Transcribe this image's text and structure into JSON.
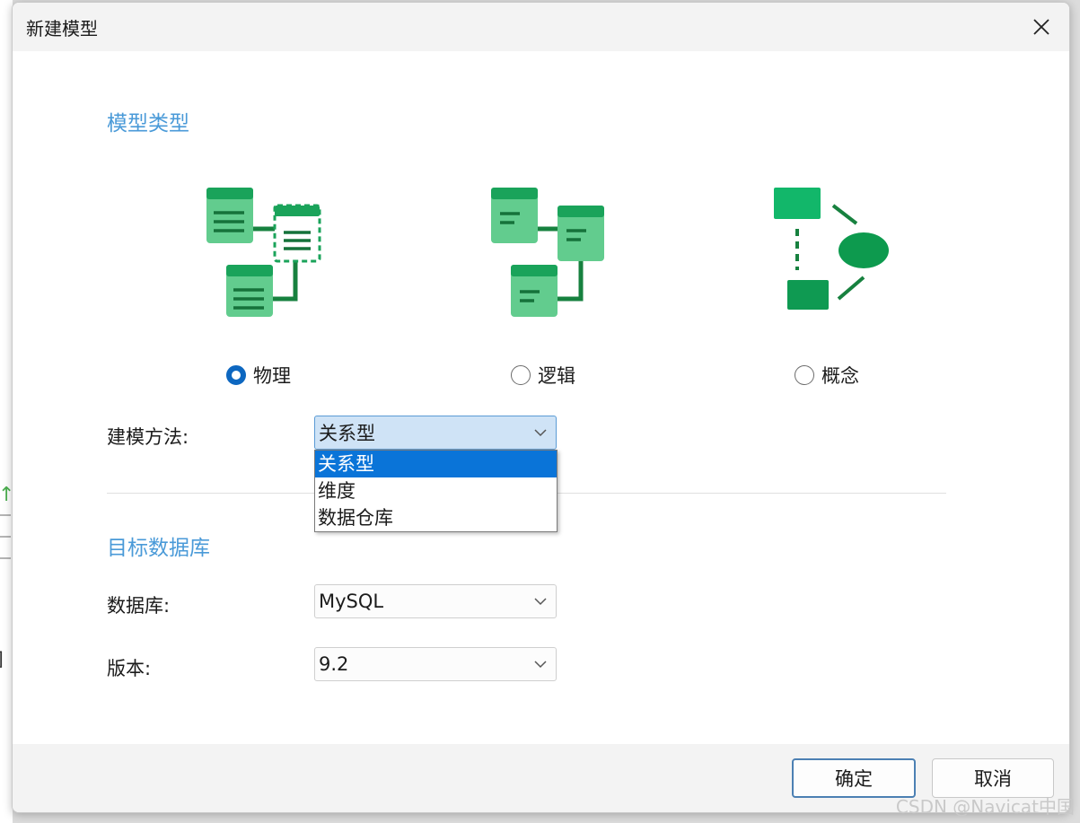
{
  "dialog": {
    "title": "新建模型"
  },
  "model_type": {
    "section_title": "模型类型",
    "options": [
      {
        "label": "物理",
        "checked": true,
        "icon": "physical-model-icon"
      },
      {
        "label": "逻辑",
        "checked": false,
        "icon": "logical-model-icon"
      },
      {
        "label": "概念",
        "checked": false,
        "icon": "conceptual-model-icon"
      }
    ]
  },
  "modeling_method": {
    "label": "建模方法:",
    "value": "关系型",
    "options": [
      "关系型",
      "维度",
      "数据仓库"
    ],
    "selected_index": 0
  },
  "target_db": {
    "section_title": "目标数据库",
    "database_label": "数据库:",
    "database_value": "MySQL",
    "version_label": "版本:",
    "version_value": "9.2"
  },
  "buttons": {
    "ok": "确定",
    "cancel": "取消"
  },
  "watermark": "CSDN @Navicat中国",
  "colors": {
    "accent": "#4a9ad8",
    "radio_checked": "#0d67c0",
    "selected_item": "#0a74d8",
    "icon_green": "#1aa35a"
  }
}
